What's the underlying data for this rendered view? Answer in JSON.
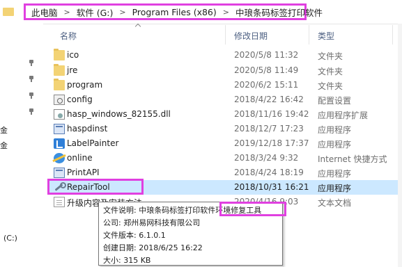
{
  "breadcrumb": [
    "此电脑",
    "软件 (G:)",
    "Program Files (x86)",
    "中琅条码标签打印软件"
  ],
  "columns": {
    "name": "名称",
    "date": "修改日期",
    "type": "类型"
  },
  "nav_labels": [
    "金",
    "金",
    "(C:)"
  ],
  "files": [
    {
      "name": "ico",
      "date": "2020/5/8 11:32",
      "type": "文件夹",
      "icon": "folder-icon"
    },
    {
      "name": "jre",
      "date": "2020/5/8 11:49",
      "type": "文件夹",
      "icon": "folder-icon"
    },
    {
      "name": "program",
      "date": "2020/6/2 15:11",
      "type": "文件夹",
      "icon": "folder-icon"
    },
    {
      "name": "config",
      "date": "2018/4/22 16:42",
      "type": "配置设置",
      "icon": "config-file-icon"
    },
    {
      "name": "hasp_windows_82155.dll",
      "date": "2018/11/16 19:42",
      "type": "应用程序扩展",
      "icon": "dll-icon"
    },
    {
      "name": "haspdinst",
      "date": "2018/12/7 17:23",
      "type": "应用程序",
      "icon": "exe-icon"
    },
    {
      "name": "LabelPainter",
      "date": "2019/12/18 17:37",
      "type": "应用程序",
      "icon": "labelpainter-icon"
    },
    {
      "name": "online",
      "date": "2018/3/24 9:32",
      "type": "Internet 快捷方式",
      "icon": "internet-shortcut-icon"
    },
    {
      "name": "PrintAPI",
      "date": "2018/4/24 18:19",
      "type": "应用程序",
      "icon": "exe-icon"
    },
    {
      "name": "RepairTool",
      "date": "2018/10/31 16:21",
      "type": "应用程序",
      "icon": "wrench-icon"
    },
    {
      "name": "升级内容及安装方法",
      "date": "2020/4/16 9:03",
      "type": "文本文档",
      "icon": "text-doc-icon"
    }
  ],
  "tooltip": {
    "desc": "文件说明: 中琅条码标签打印软件环境修复工具",
    "company": "公司: 郑州易网科技有限公司",
    "version": "文件版本: 6.1.0.1",
    "created": "创建日期: 2018/6/25 16:22",
    "size": "大小: 315 KB"
  },
  "colors": {
    "highlight": "#e040e0",
    "selection": "#cce8ff",
    "header_text": "#4d6082"
  }
}
